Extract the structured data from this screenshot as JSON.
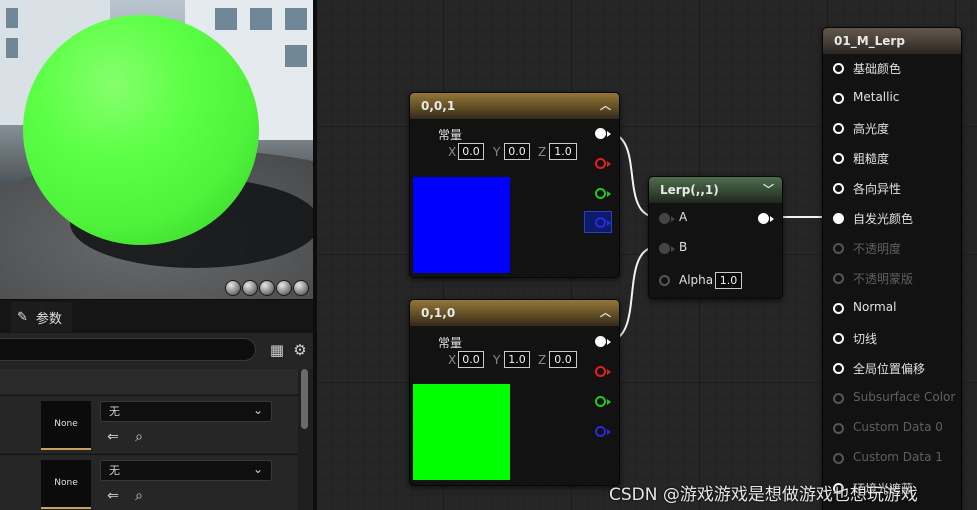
{
  "panel": {
    "tab_params_label": "参数",
    "rows": [
      {
        "thumb_label": "None",
        "dropdown_value": "无"
      },
      {
        "thumb_label": "None",
        "dropdown_value": "无"
      }
    ]
  },
  "nodes": {
    "const_blue": {
      "title": "0,0,1",
      "subtitle": "常量",
      "x_label": "X",
      "x_value": "0.0",
      "y_label": "Y",
      "y_value": "0.0",
      "z_label": "Z",
      "z_value": "1.0",
      "swatch_color": "#0000ff"
    },
    "const_green": {
      "title": "0,1,0",
      "subtitle": "常量",
      "x_label": "X",
      "x_value": "0.0",
      "y_label": "Y",
      "y_value": "1.0",
      "z_label": "Z",
      "z_value": "0.0",
      "swatch_color": "#00ff00"
    },
    "lerp": {
      "title": "Lerp(,,1)",
      "in_a": "A",
      "in_b": "B",
      "in_alpha": "Alpha",
      "alpha_value": "1.0"
    },
    "result": {
      "title": "01_M_Lerp",
      "pins": [
        {
          "label": "基础颜色",
          "enabled": true
        },
        {
          "label": "Metallic",
          "enabled": true
        },
        {
          "label": "高光度",
          "enabled": true
        },
        {
          "label": "粗糙度",
          "enabled": true
        },
        {
          "label": "各向异性",
          "enabled": true
        },
        {
          "label": "自发光颜色",
          "enabled": true,
          "connected": true
        },
        {
          "label": "不透明度",
          "enabled": false
        },
        {
          "label": "不透明蒙版",
          "enabled": false
        },
        {
          "label": "Normal",
          "enabled": true
        },
        {
          "label": "切线",
          "enabled": true
        },
        {
          "label": "全局位置偏移",
          "enabled": true
        },
        {
          "label": "Subsurface Color",
          "enabled": false
        },
        {
          "label": "Custom Data 0",
          "enabled": false
        },
        {
          "label": "Custom Data 1",
          "enabled": false
        },
        {
          "label": "环境光遮蔽",
          "enabled": true
        }
      ]
    }
  },
  "pin_colors": {
    "white": "#ffffff",
    "red": "#e02020",
    "green": "#22c922",
    "blue": "#2a2ae0"
  },
  "preview_color": "#5cff45",
  "watermark": "CSDN @游戏游戏是想做游戏也想玩游戏"
}
